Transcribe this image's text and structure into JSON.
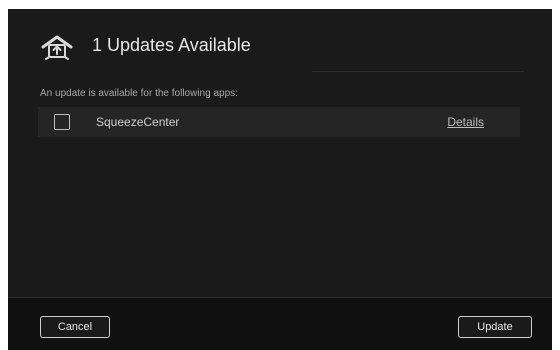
{
  "dialog": {
    "title": "1 Updates Available",
    "icon": "cloud-upload-icon",
    "prompt": "An update is available for the following apps:",
    "apps": [
      {
        "name": "SqueezeCenter",
        "checked": false,
        "details_label": "Details"
      }
    ]
  },
  "footer": {
    "cancel_label": "Cancel",
    "update_label": "Update"
  },
  "colors": {
    "background": "#1a1a1a",
    "row": "#252525",
    "footer": "#101010",
    "text": "#e6e6e6"
  }
}
